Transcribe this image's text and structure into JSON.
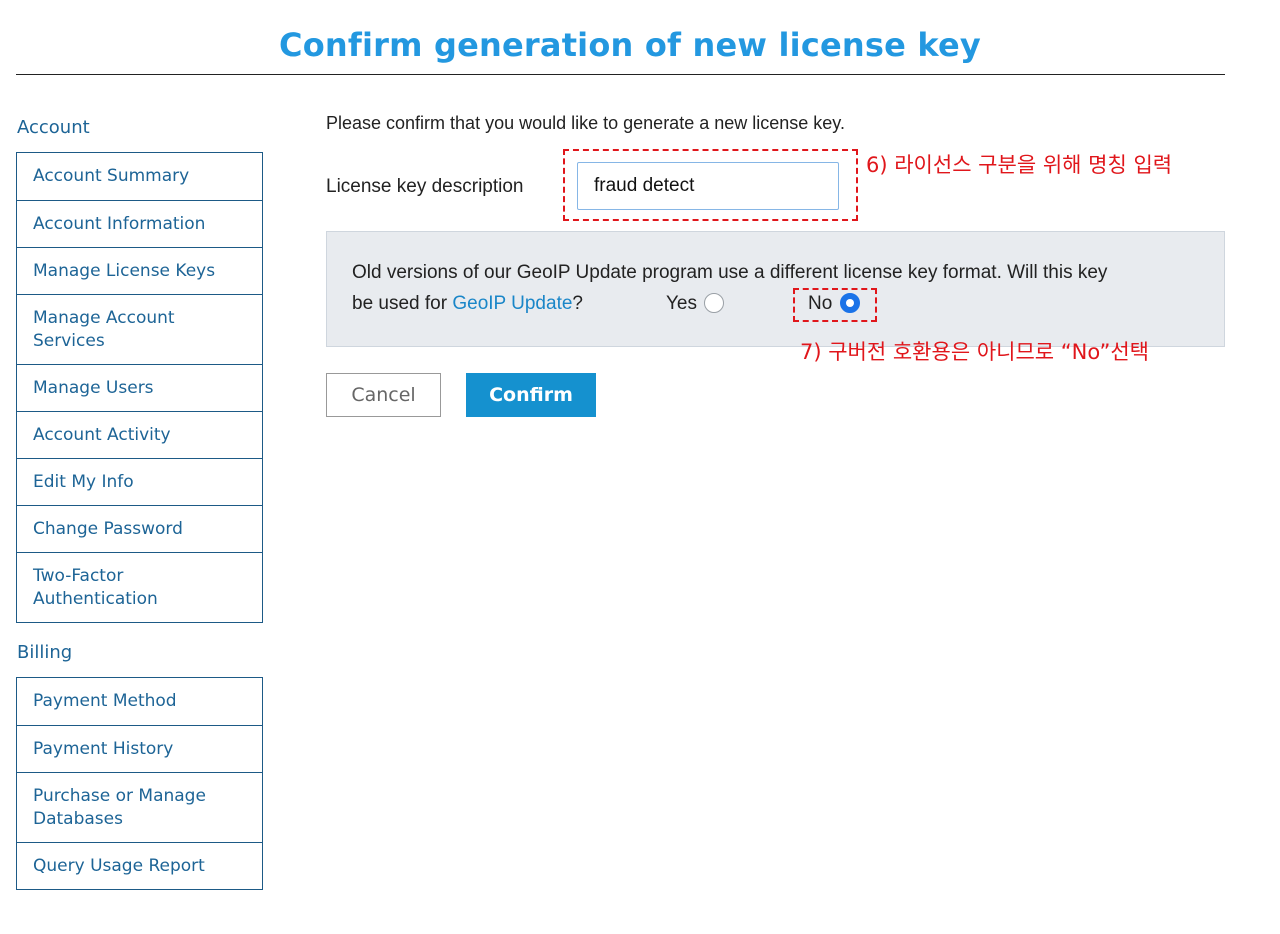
{
  "page": {
    "title": "Confirm generation of new license key"
  },
  "sidebar": {
    "account_heading": "Account",
    "account_items": [
      {
        "label": "Account Summary"
      },
      {
        "label": "Account Information"
      },
      {
        "label": "Manage License Keys"
      },
      {
        "label": "Manage Account Services"
      },
      {
        "label": "Manage Users"
      },
      {
        "label": "Account Activity"
      },
      {
        "label": "Edit My Info"
      },
      {
        "label": "Change Password"
      },
      {
        "label": "Two-Factor Authentication"
      }
    ],
    "billing_heading": "Billing",
    "billing_items": [
      {
        "label": "Payment Method"
      },
      {
        "label": "Payment History"
      },
      {
        "label": "Purchase or Manage Databases"
      },
      {
        "label": "Query Usage Report"
      }
    ]
  },
  "main": {
    "intro": "Please confirm that you would like to generate a new license key.",
    "description_label": "License key description",
    "description_value": "fraud detect",
    "question_line1": "Old versions of our GeoIP Update program use a different license key format. Will this key",
    "question_prefix": "be used for ",
    "question_link": "GeoIP Update",
    "question_suffix": "?",
    "options": [
      {
        "label": "Yes",
        "selected": false
      },
      {
        "label": "No",
        "selected": true
      }
    ],
    "cancel_label": "Cancel",
    "confirm_label": "Confirm"
  },
  "annotations": {
    "step6": "6) 라이선스 구분을 위해 명칭 입력",
    "step7": "7) 구버전 호환용은 아니므로 “No”선택"
  },
  "colors": {
    "title": "#2398e0",
    "sidebar_text": "#1d6496",
    "link": "#1a86c8",
    "confirm_button": "#1591cf",
    "annotation": "#e0161b",
    "panel_bg": "#e8ebef",
    "radio_selected": "#1a73e8"
  }
}
